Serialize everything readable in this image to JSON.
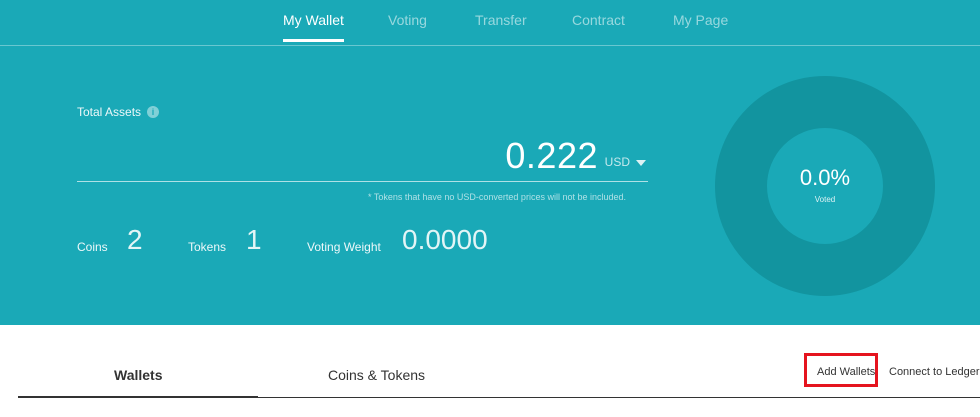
{
  "topnav": {
    "tabs": [
      {
        "label": "My Wallet",
        "active": true
      },
      {
        "label": "Voting",
        "active": false
      },
      {
        "label": "Transfer",
        "active": false
      },
      {
        "label": "Contract",
        "active": false
      },
      {
        "label": "My Page",
        "active": false
      }
    ]
  },
  "assets": {
    "label": "Total Assets",
    "info_icon": "info-icon",
    "amount": "0.222",
    "currency": "USD",
    "note": "* Tokens that have no USD-converted prices will not be included."
  },
  "stats": {
    "coins_label": "Coins",
    "coins_value": "2",
    "tokens_label": "Tokens",
    "tokens_value": "1",
    "voting_weight_label": "Voting Weight",
    "voting_weight_value": "0.0000"
  },
  "vote": {
    "percent_text": "0.0%",
    "sub_label": "Voted",
    "voted_fraction": 0.0
  },
  "lower_tabs": {
    "wallets": "Wallets",
    "coins_tokens": "Coins & Tokens"
  },
  "actions": {
    "add_wallets": "Add Wallets",
    "connect_ledger": "Connect to Ledger"
  },
  "colors": {
    "hero_bg": "#1aa9b7",
    "donut_ring": "#12949f",
    "highlight": "#e5141e"
  }
}
